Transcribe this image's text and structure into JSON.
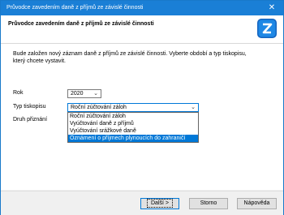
{
  "window": {
    "title": "Průvodce zavedením daně z příjmů ze závislé činnosti"
  },
  "header": {
    "title": "Průvodce zavedením daně z příjmů ze závislé činnosti"
  },
  "content": {
    "description": "Bude založen nový záznam daně z příjmů ze závislé činnosti. Vyberte období a typ tiskopisu, který chcete vystavit.",
    "rok_label": "Rok",
    "rok_value": "2020",
    "typ_label": "Typ tiskopisu",
    "typ_value": "Roční zúčtování záloh",
    "druh_label": "Druh přiznání",
    "typ_options": [
      "Roční zúčtování záloh",
      "Vyúčtování daně z příjmů",
      "Vyúčtování srážkové daně",
      "Oznámení o příjmech plynoucích do zahraničí"
    ]
  },
  "buttons": {
    "next": "Další >",
    "cancel": "Storno",
    "help": "Nápověda"
  },
  "colors": {
    "titlebar": "#1a7fd6",
    "selection": "#0078d7"
  }
}
